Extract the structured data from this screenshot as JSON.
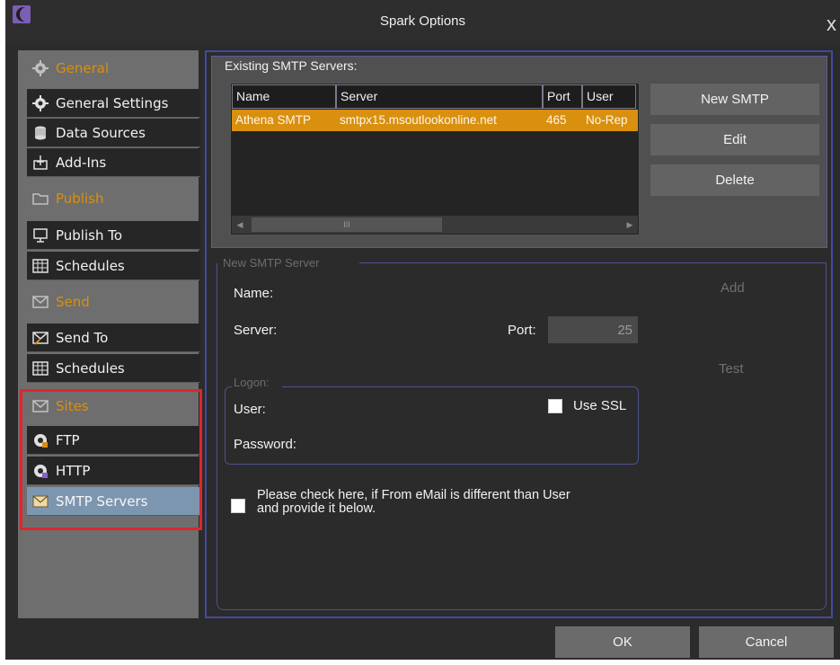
{
  "window": {
    "title": "Spark Options",
    "close": "x"
  },
  "sidebar": {
    "sections": [
      {
        "label": "General",
        "items": [
          "General Settings",
          "Data Sources",
          "Add-Ins"
        ]
      },
      {
        "label": "Publish",
        "items": [
          "Publish To",
          "Schedules"
        ]
      },
      {
        "label": "Send",
        "items": [
          "Send To",
          "Schedules"
        ]
      },
      {
        "label": "Sites",
        "items": [
          "FTP",
          "HTTP",
          "SMTP Servers"
        ]
      }
    ],
    "selected": "SMTP Servers"
  },
  "existing": {
    "title": "Existing SMTP Servers:",
    "columns": [
      "Name",
      "Server",
      "Port",
      "User"
    ],
    "rows": [
      {
        "name": "Athena SMTP",
        "server": "smtpx15.msoutlookonline.net",
        "port": "465",
        "user": "No-Rep"
      }
    ],
    "scroll_thumb": "III",
    "buttons": {
      "new": "New SMTP",
      "edit": "Edit",
      "delete": "Delete"
    }
  },
  "new_server": {
    "title": "New SMTP Server",
    "name_label": "Name:",
    "server_label": "Server:",
    "port_label": "Port:",
    "port_value": "25",
    "add": "Add",
    "test": "Test",
    "logon": {
      "title": "Logon:",
      "user_label": "User:",
      "password_label": "Password:",
      "ssl_label": "Use SSL"
    },
    "from_email_check": {
      "line1": "Please check here, if From eMail is different than User",
      "line2": "and provide it below."
    }
  },
  "footer": {
    "ok": "OK",
    "cancel": "Cancel"
  },
  "colors": {
    "accent": "#d9900f",
    "selection": "#7d96b0",
    "highlight": "#e0252e",
    "frame": "#434aa0"
  }
}
